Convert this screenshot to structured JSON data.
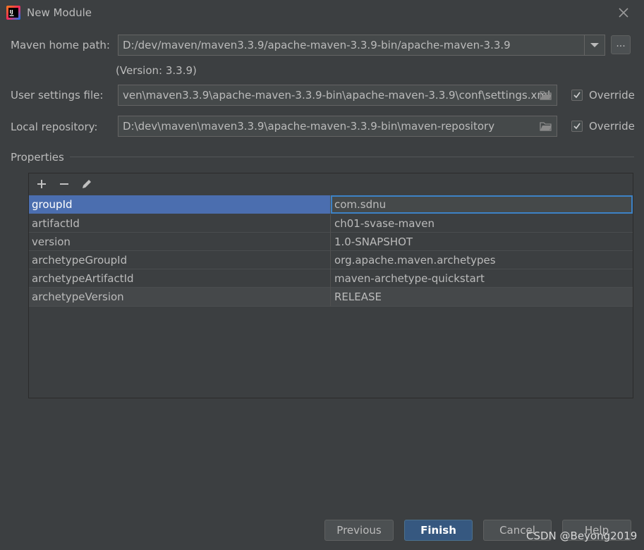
{
  "window": {
    "title": "New Module",
    "icon": "intellij-idea-icon"
  },
  "maven_home": {
    "label": "Maven home path:",
    "value": "D:/dev/maven/maven3.3.9/apache-maven-3.3.9-bin/apache-maven-3.3.9",
    "browse_label": "...",
    "version_text": "(Version: 3.3.9)"
  },
  "user_settings": {
    "label": "User settings file:",
    "value": "ven\\maven3.3.9\\apache-maven-3.3.9-bin\\apache-maven-3.3.9\\conf\\settings.xml",
    "override_label": "Override",
    "override_checked": true
  },
  "local_repo": {
    "label": "Local repository:",
    "value": "D:\\dev\\maven\\maven3.3.9\\apache-maven-3.3.9-bin\\maven-repository",
    "override_label": "Override",
    "override_checked": true
  },
  "properties": {
    "title": "Properties",
    "toolbar": {
      "add": "+",
      "remove": "−"
    },
    "rows": [
      {
        "key": "groupId",
        "value": "com.sdnu"
      },
      {
        "key": "artifactId",
        "value": "ch01-svase-maven"
      },
      {
        "key": "version",
        "value": "1.0-SNAPSHOT"
      },
      {
        "key": "archetypeGroupId",
        "value": "org.apache.maven.archetypes"
      },
      {
        "key": "archetypeArtifactId",
        "value": "maven-archetype-quickstart"
      },
      {
        "key": "archetypeVersion",
        "value": "RELEASE"
      }
    ]
  },
  "buttons": {
    "previous": "Previous",
    "finish": "Finish",
    "cancel": "Cancel",
    "help": "Help"
  },
  "watermark": "CSDN @Beyong2019",
  "colors": {
    "accent": "#4b6eaf",
    "primary_button": "#365880",
    "background": "#3c3f41"
  }
}
